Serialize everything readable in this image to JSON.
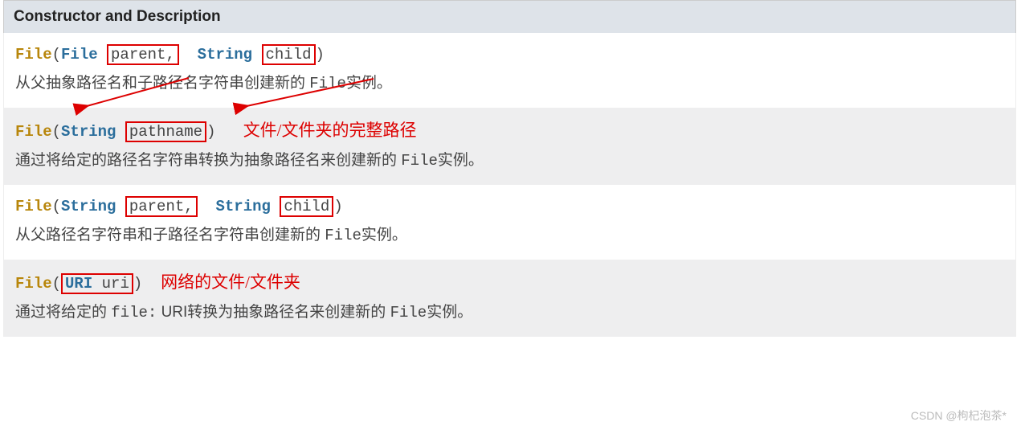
{
  "header": "Constructor and Description",
  "rows": [
    {
      "cls": "File",
      "type1": "File",
      "param1": "parent,",
      "type2": "String",
      "param2": "child",
      "desc_pre": "从父抽象路径名和子路径名字符串创建新的 ",
      "desc_code": "File",
      "desc_post": "实例。",
      "note": ""
    },
    {
      "cls": "File",
      "type1": "String",
      "param1": "pathname",
      "note": "文件/文件夹的完整路径",
      "desc_pre": "通过将给定的路径名字符串转换为抽象路径名来创建新的 ",
      "desc_code": "File",
      "desc_post": "实例。"
    },
    {
      "cls": "File",
      "type1": "String",
      "param1": "parent,",
      "type2": "String",
      "param2": "child",
      "desc_pre": "从父路径名字符串和子路径名字符串创建新的 ",
      "desc_code": "File",
      "desc_post": "实例。",
      "note": ""
    },
    {
      "cls": "File",
      "type1": "URI",
      "param1": "uri",
      "note": "网络的文件/文件夹",
      "desc_pre": "通过将给定的 ",
      "desc_mid": "file:",
      "desc_mid2": " URI转换为抽象路径名来创建新的 ",
      "desc_code": "File",
      "desc_post": "实例。"
    }
  ],
  "watermark": "CSDN @枸杞泡茶*"
}
